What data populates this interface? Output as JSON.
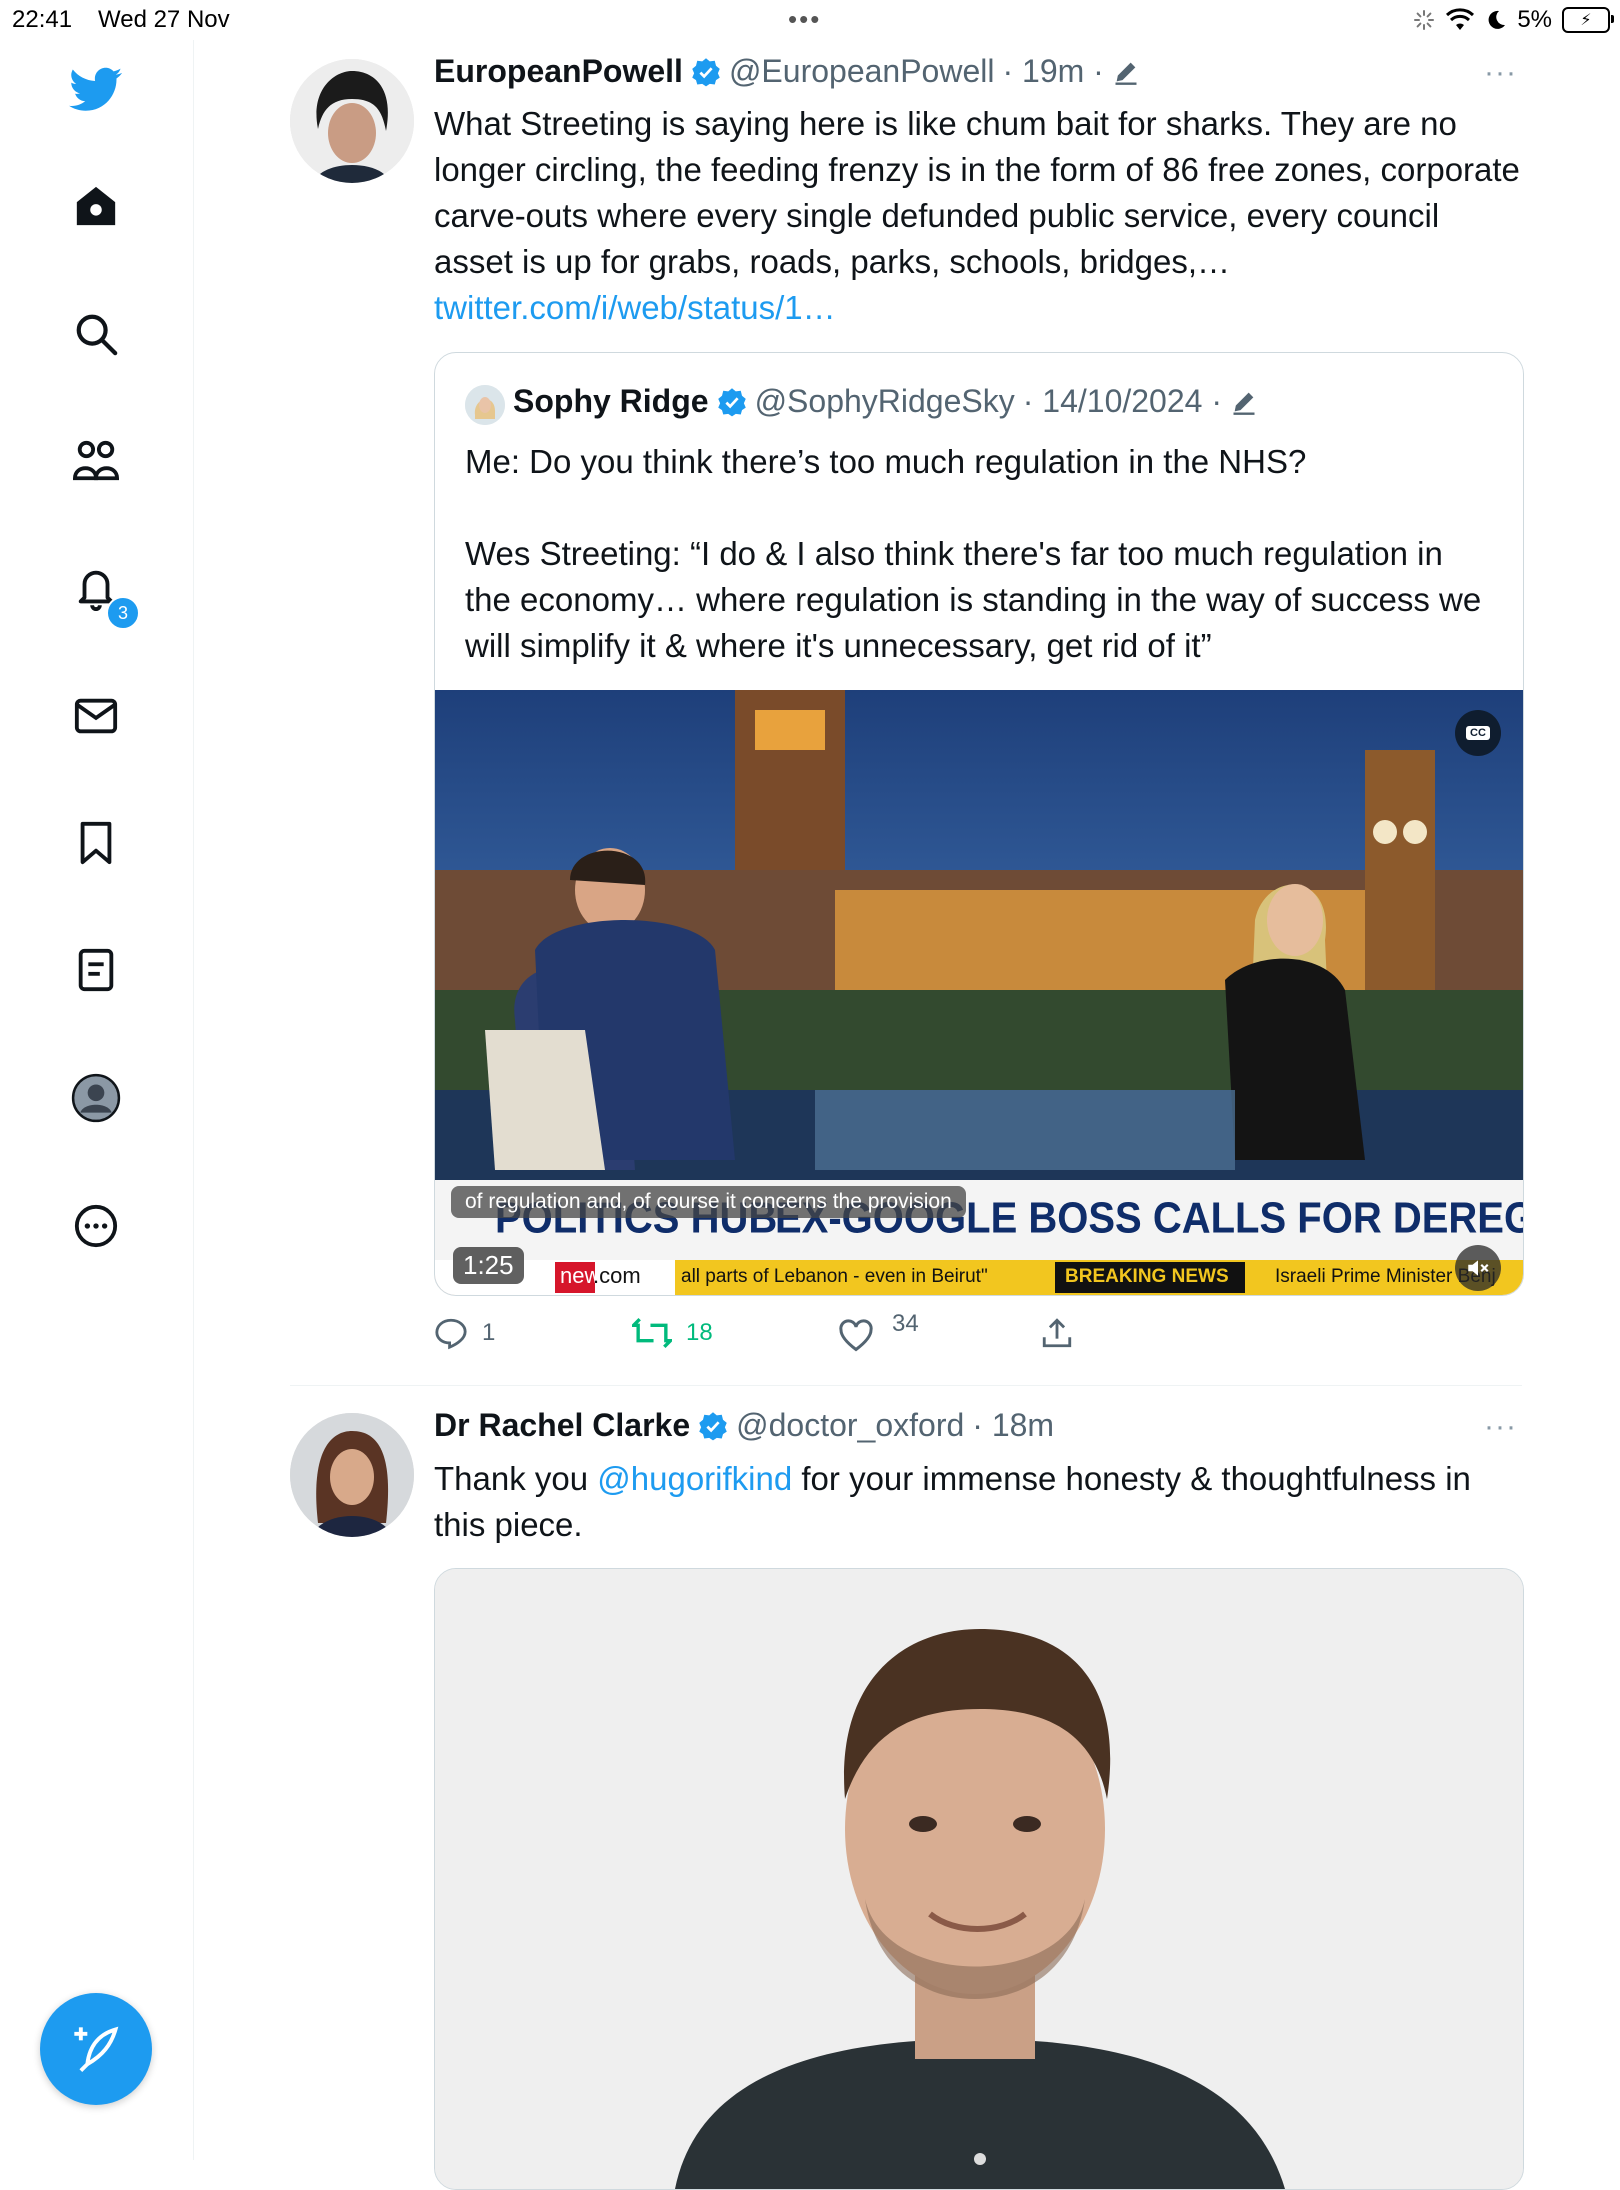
{
  "status_bar": {
    "time": "22:41",
    "date": "Wed 27 Nov",
    "battery_pct": "5%"
  },
  "sidebar": {
    "items": [
      {
        "name": "twitter-logo-icon"
      },
      {
        "name": "home-icon"
      },
      {
        "name": "search-icon"
      },
      {
        "name": "communities-icon"
      },
      {
        "name": "notifications-icon"
      },
      {
        "name": "messages-icon"
      },
      {
        "name": "bookmarks-icon"
      },
      {
        "name": "lists-icon"
      },
      {
        "name": "profile-icon"
      },
      {
        "name": "more-icon"
      }
    ],
    "notification_count": "3",
    "compose_icon": "compose-tweet-icon"
  },
  "tweet1": {
    "name": "EuropeanPowell",
    "handle": "@EuropeanPowell",
    "time": "· 19m ·",
    "more": "···",
    "text": "What Streeting is saying here is like chum bait for sharks. They are no longer circling, the feeding frenzy is in the form of 86 free zones, corporate carve-outs where every single defunded public service, every council asset is up for grabs, roads, parks, schools, bridges,…",
    "link": "twitter.com/i/web/status/1…",
    "quote": {
      "name": "Sophy Ridge",
      "handle": "@SophyRidgeSky",
      "time": "· 14/10/2024 ·",
      "line1": "Me: Do you think there’s too much regulation in the NHS?",
      "line2": "Wes Streeting: “I do & I also think there's far too much regulation in the economy… where regulation is standing in the way of success we will simplify it & where it's unnecessary, get rid of it”",
      "video": {
        "caption": "of regulation and, of course it concerns the provision",
        "duration": "1:25",
        "cc": "CC",
        "headline_left": "POLITICS HUB",
        "headline_right": "EX-GOOGLE BOSS CALLS FOR DEREGULATION",
        "brand_news": "news",
        "brand_com": ".com",
        "ticker1": "all parts of Lebanon - even in Beirut\"",
        "breaking": "BREAKING NEWS",
        "ticker2": "Israeli Prime Minister Benj"
      }
    },
    "actions": {
      "replies": "1",
      "retweets": "18",
      "likes": "34"
    }
  },
  "tweet2": {
    "name": "Dr Rachel Clarke",
    "handle": "@doctor_oxford",
    "time": "· 18m",
    "more": "···",
    "text_pre": "Thank you ",
    "mention": "@hugorifkind",
    "text_post": " for your immense honesty & thoughtfulness in this piece."
  }
}
